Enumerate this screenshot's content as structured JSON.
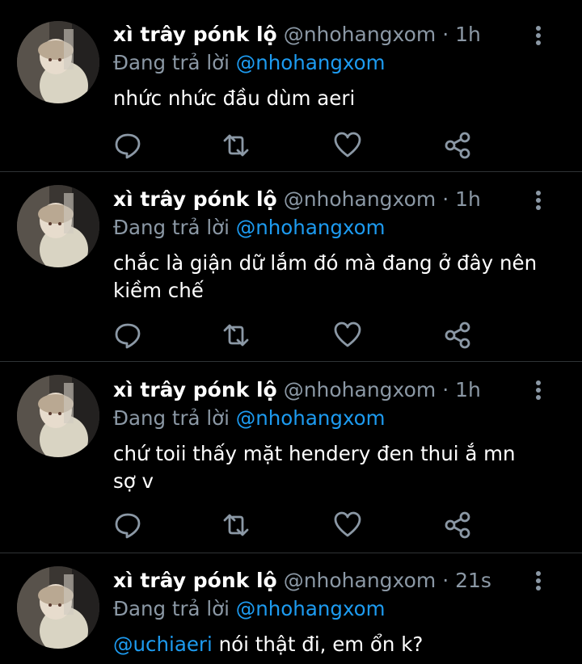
{
  "tweets": [
    {
      "display_name": "xì trây pónk lộ",
      "handle": "@nhohangxom",
      "dot": "·",
      "time": "1h",
      "reply_prefix": "Đang trả lời",
      "reply_to": "@nhohangxom",
      "text": "nhức nhức đầu dùm aeri"
    },
    {
      "display_name": "xì trây pónk lộ",
      "handle": "@nhohangxom",
      "dot": "·",
      "time": "1h",
      "reply_prefix": "Đang trả lời",
      "reply_to": "@nhohangxom",
      "text_line1": "chắc là giận dữ lắm đó mà đang ở đây nên",
      "text_line2": "kiềm chế"
    },
    {
      "display_name": "xì trây pónk lộ",
      "handle": "@nhohangxom",
      "dot": "·",
      "time": "1h",
      "reply_prefix": "Đang trả lời",
      "reply_to": "@nhohangxom",
      "text_line1": "chứ toii thấy mặt hendery đen thui ắ mn",
      "text_line2": "sợ v"
    },
    {
      "display_name": "xì trây pónk lộ",
      "handle": "@nhohangxom",
      "dot": "·",
      "time": "21s",
      "reply_prefix": "Đang trả lời",
      "reply_to": "@nhohangxom",
      "mention": "@uchiaeri",
      "text": "nói thật đi, em ổn k?"
    }
  ],
  "icons": [
    "more-vertical-icon",
    "reply-icon",
    "retweet-icon",
    "like-icon",
    "share-icon"
  ],
  "colors": {
    "background": "#000000",
    "primary_text": "#ffffff",
    "secondary_text": "#8b98a5",
    "link": "#1d9bf0",
    "divider": "#2f3336"
  }
}
